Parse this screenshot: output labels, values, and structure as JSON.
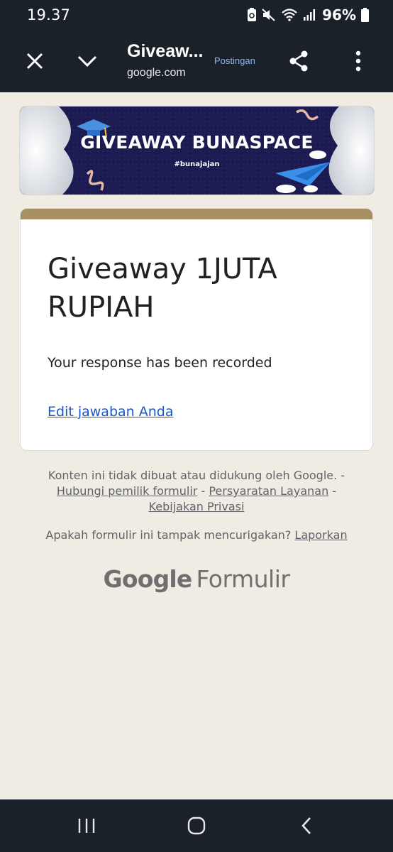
{
  "status_bar": {
    "time": "19.37",
    "battery": "96%"
  },
  "toolbar": {
    "title": "Giveaw...",
    "url": "google.com",
    "badge": "Postingan"
  },
  "banner": {
    "title": "GIVEAWAY BUNASPACE",
    "hashtag": "#bunajajan"
  },
  "form": {
    "title": "Giveaway 1JUTA RUPIAH",
    "confirmation": "Your response has been recorded",
    "edit_link": "Edit jawaban Anda",
    "accent_color": "#a69064"
  },
  "footer": {
    "disclaimer": "Konten ini tidak dibuat atau didukung oleh Google.",
    "sep": "-",
    "contact_owner": "Hubungi pemilik formulir",
    "terms": "Persyaratan Layanan",
    "privacy": "Kebijakan Privasi",
    "report_question": "Apakah formulir ini tampak mencurigakan?",
    "report_link": "Laporkan",
    "brand_google": "Google",
    "brand_forms": "Formulir"
  },
  "icons": {
    "close": "close-icon",
    "chevron": "chevron-down-icon",
    "share": "share-icon",
    "more": "more-vert-icon",
    "nav_recents": "recents-icon",
    "nav_home": "home-icon",
    "nav_back": "back-icon"
  }
}
